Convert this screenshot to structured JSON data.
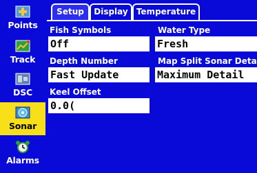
{
  "sidebar": {
    "items": [
      {
        "label": "Points",
        "icon": "points-icon"
      },
      {
        "label": "Track",
        "icon": "track-icon"
      },
      {
        "label": "DSC",
        "icon": "dsc-icon"
      },
      {
        "label": "Sonar",
        "icon": "sonar-icon",
        "active": true
      },
      {
        "label": "Alarms",
        "icon": "alarm-clock-icon"
      }
    ]
  },
  "tabs": [
    {
      "label": "Setup",
      "active": true
    },
    {
      "label": "Display"
    },
    {
      "label": "Temperature"
    }
  ],
  "fields": {
    "fish_symbols": {
      "label": "Fish Symbols",
      "value": "Off"
    },
    "water_type": {
      "label": "Water Type",
      "value": "Fresh"
    },
    "depth_number": {
      "label": "Depth Number",
      "value": "Fast Update"
    },
    "map_split_sonar_detail": {
      "label": "Map Split Sonar Detail",
      "value": "Maximum Detail"
    },
    "keel_offset": {
      "label": "Keel Offset",
      "value": "0.0("
    }
  },
  "colors": {
    "background": "#0a0ad8",
    "active_item": "#f7df1a",
    "field": "#ffffff",
    "text": "#ffffff"
  }
}
